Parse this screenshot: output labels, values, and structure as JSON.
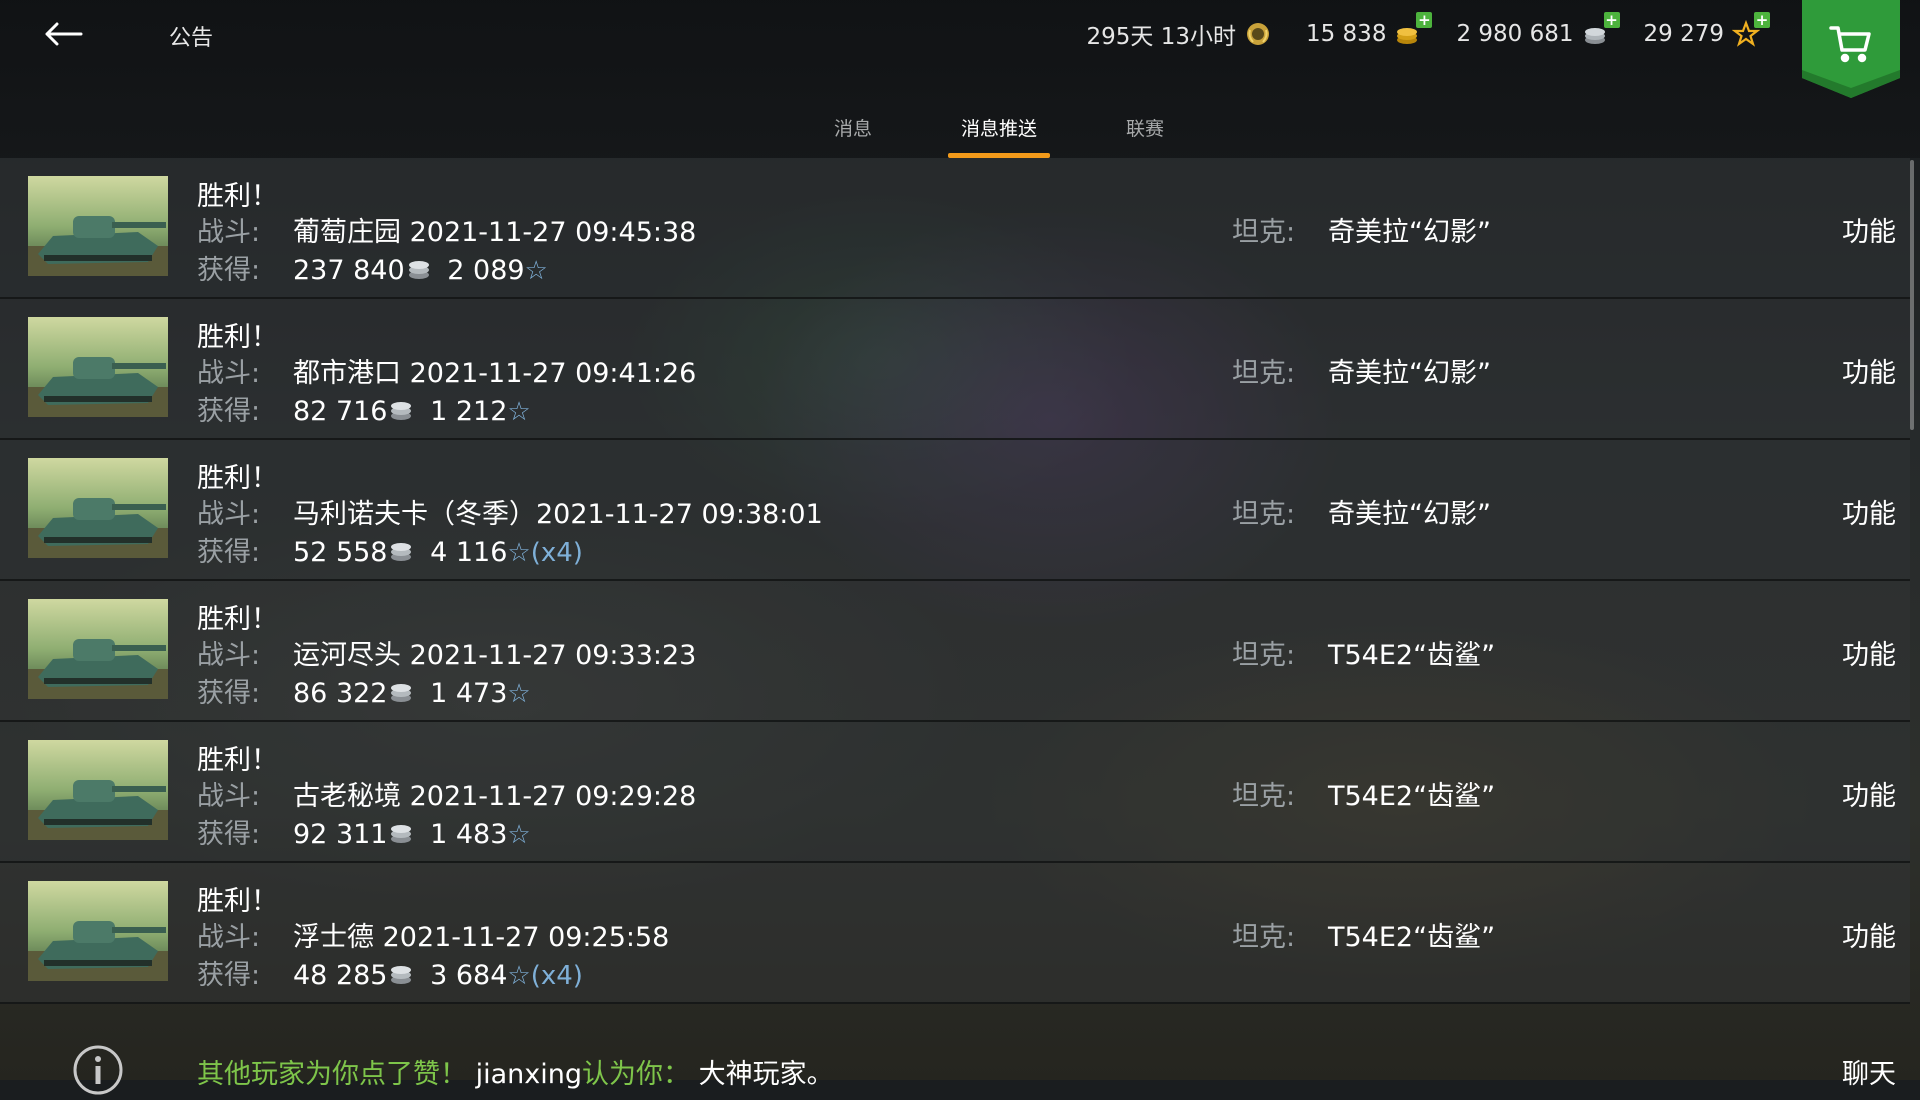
{
  "header": {
    "title": "公告",
    "resources": [
      {
        "value": "295天 13小时",
        "icon": "premium-laurel-icon"
      },
      {
        "value": "15 838",
        "icon": "gold-coins-icon"
      },
      {
        "value": "2 980 681",
        "icon": "silver-coins-icon"
      },
      {
        "value": "29 279",
        "icon": "free-xp-star-icon"
      }
    ]
  },
  "tabs": [
    {
      "label": "消息",
      "active": false
    },
    {
      "label": "消息推送",
      "active": true
    },
    {
      "label": "联赛",
      "active": false
    }
  ],
  "labels": {
    "battle": "战斗:",
    "earned": "获得:",
    "tank": "坦克:",
    "function": "功能",
    "star": "☆"
  },
  "messages": [
    {
      "title": "胜利！",
      "battle": "葡萄庄园 2021-11-27 09:45:38",
      "silver": "237 840",
      "xp": "2 089",
      "multiplier": "",
      "tank": "奇美拉“幻影”"
    },
    {
      "title": "胜利！",
      "battle": "都市港口 2021-11-27 09:41:26",
      "silver": "82 716",
      "xp": "1 212",
      "multiplier": "",
      "tank": "奇美拉“幻影”"
    },
    {
      "title": "胜利！",
      "battle": "马利诺夫卡（冬季）2021-11-27 09:38:01",
      "silver": "52 558",
      "xp": "4 116",
      "multiplier": "(x4)",
      "tank": "奇美拉“幻影”"
    },
    {
      "title": "胜利！",
      "battle": "运河尽头 2021-11-27 09:33:23",
      "silver": "86 322",
      "xp": "1 473",
      "multiplier": "",
      "tank": "T54E2“齿鲨”"
    },
    {
      "title": "胜利！",
      "battle": "古老秘境 2021-11-27 09:29:28",
      "silver": "92 311",
      "xp": "1 483",
      "multiplier": "",
      "tank": "T54E2“齿鲨”"
    },
    {
      "title": "胜利！",
      "battle": "浮士德 2021-11-27 09:25:58",
      "silver": "48 285",
      "xp": "3 684",
      "multiplier": "(x4)",
      "tank": "T54E2“齿鲨”"
    }
  ],
  "bottom": {
    "praise_green": "其他玩家为你点了赞！",
    "player": "jianxing",
    "praise_text": "认为你：",
    "praise_value": "大神玩家。",
    "chat": "聊天"
  },
  "colors": {
    "accent": "#f29a1a",
    "shop": "#2f9b3a",
    "praise": "#7ec54a",
    "label": "#9aa0a4",
    "star": "#7fb0d8"
  }
}
